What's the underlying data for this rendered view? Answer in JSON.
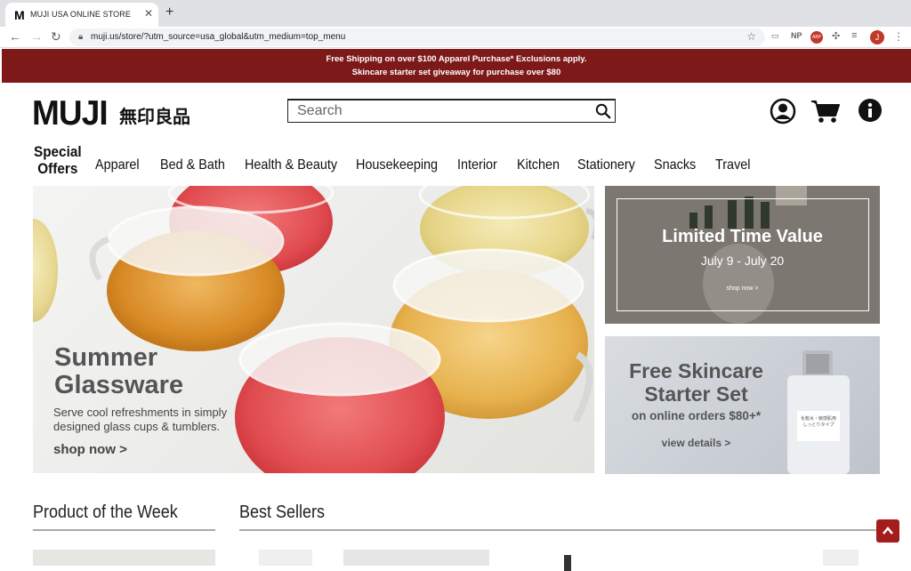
{
  "browser": {
    "tab_title": "MUJI USA ONLINE STORE",
    "tab_favicon": "M",
    "url": "muji.us/store/?utm_source=usa_global&utm_medium=top_menu",
    "extensions": [
      "NP",
      "ABP"
    ],
    "profile_initial": "J"
  },
  "promo_bar": {
    "line1": "Free Shipping on over $100 Apparel Purchase* Exclusions apply.",
    "line2": "Skincare starter set giveaway for purchase over $80",
    "color": "#7d1919"
  },
  "header": {
    "logo": "MUJI",
    "logo_jp": "無印良品",
    "search_placeholder": "Search"
  },
  "nav": {
    "special_line1": "Special",
    "special_line2": "Offers",
    "items": [
      "Apparel",
      "Bed & Bath",
      "Health & Beauty",
      "Housekeeping",
      "Interior",
      "Kitchen",
      "Stationery",
      "Snacks",
      "Travel"
    ]
  },
  "hero": {
    "title_line1": "Summer",
    "title_line2": "Glassware",
    "subtitle": "Serve cool refreshments in simply designed glass cups & tumblers.",
    "cta": "shop now >"
  },
  "promo_limited": {
    "title": "Limited Time Value",
    "dates": "July 9 - July 20",
    "cta": "shop now >"
  },
  "promo_skincare": {
    "title_line1": "Free Skincare",
    "title_line2": "Starter Set",
    "subtitle": "on online orders $80+*",
    "cta": "view details >",
    "bottle_label": "化粧水・敏感肌用 しっとりタイプ"
  },
  "sections": {
    "product_of_week": "Product of the Week",
    "best_sellers": "Best Sellers"
  },
  "colors": {
    "brand_red": "#7d1919",
    "scroll_top": "#a31d1d"
  }
}
